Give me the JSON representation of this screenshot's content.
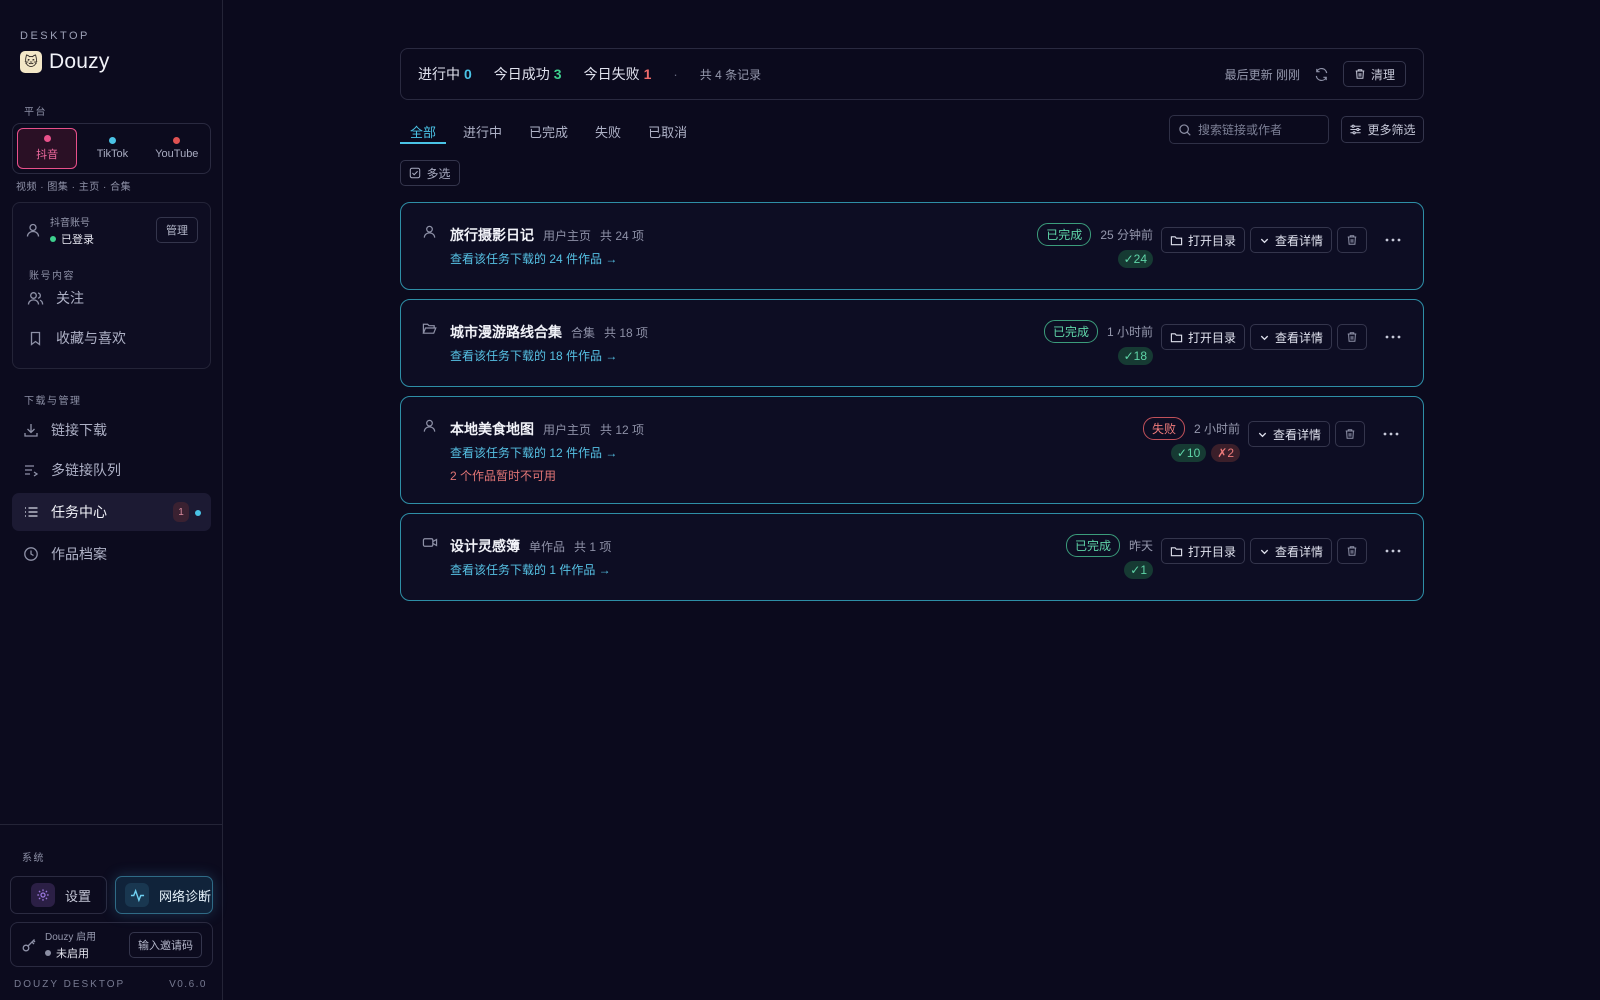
{
  "sidebar": {
    "brand_small": "DESKTOP",
    "brand_name": "Douzy",
    "platform_label": "平台",
    "platforms": [
      {
        "label": "抖音",
        "color": "#e8508a"
      },
      {
        "label": "TikTok",
        "color": "#4ac3e6"
      },
      {
        "label": "YouTube",
        "color": "#e05252"
      }
    ],
    "platform_sub": "视频 · 图集 · 主页 · 合集",
    "account": {
      "title": "抖音账号",
      "status": "已登录",
      "manage": "管理",
      "content_label": "账号内容",
      "follow": "关注",
      "favorites": "收藏与喜欢"
    },
    "download_label": "下载与管理",
    "nav": {
      "link_download": "链接下载",
      "queue": "多链接队列",
      "task_center": "任务中心",
      "task_badge": "1",
      "archive": "作品档案"
    },
    "system_label": "系统",
    "settings": "设置",
    "network": "网络诊断",
    "invite": {
      "title": "Douzy 启用",
      "status": "未启用",
      "button": "输入邀请码"
    },
    "footer_left": "DOUZY DESKTOP",
    "footer_right": "V0.6.0"
  },
  "stats": {
    "running_label": "进行中",
    "running": "0",
    "success_label": "今日成功",
    "success": "3",
    "failed_label": "今日失败",
    "failed": "1",
    "sep": "·",
    "total": "共 4 条记录",
    "updated": "最后更新 刚刚",
    "clear": "清理"
  },
  "tabs": [
    "全部",
    "进行中",
    "已完成",
    "失败",
    "已取消"
  ],
  "search": {
    "placeholder": "搜索链接或作者"
  },
  "filter": "更多筛选",
  "multi_select": "多选",
  "actions": {
    "open_dir": "打开目录",
    "details": "查看详情"
  },
  "tasks": [
    {
      "name": "旅行摄影日记",
      "type": "用户主页",
      "count": "共 24 项",
      "link": "查看该任务下载的 24 件作品 →",
      "status": "已完成",
      "time": "25 分钟前",
      "ok": "✓24",
      "fail": "",
      "warn": "",
      "icon": "user-icon"
    },
    {
      "name": "城市漫游路线合集",
      "type": "合集",
      "count": "共 18 项",
      "link": "查看该任务下载的 18 件作品 →",
      "status": "已完成",
      "time": "1 小时前",
      "ok": "✓18",
      "fail": "",
      "warn": "",
      "icon": "folder-open-icon"
    },
    {
      "name": "本地美食地图",
      "type": "用户主页",
      "count": "共 12 项",
      "link": "查看该任务下载的 12 件作品 →",
      "status": "失败",
      "time": "2 小时前",
      "ok": "✓10",
      "fail": "✗2",
      "warn": "2 个作品暂时不可用",
      "icon": "user-icon"
    },
    {
      "name": "设计灵感簿",
      "type": "单作品",
      "count": "共 1 项",
      "link": "查看该任务下载的 1 件作品 →",
      "status": "已完成",
      "time": "昨天",
      "ok": "✓1",
      "fail": "",
      "warn": "",
      "icon": "video-icon"
    }
  ],
  "colors": {
    "accent": "#4ac3e6",
    "success": "#3ecf8e",
    "danger": "#ef6b6b",
    "card_border": "#2e8ea6"
  }
}
